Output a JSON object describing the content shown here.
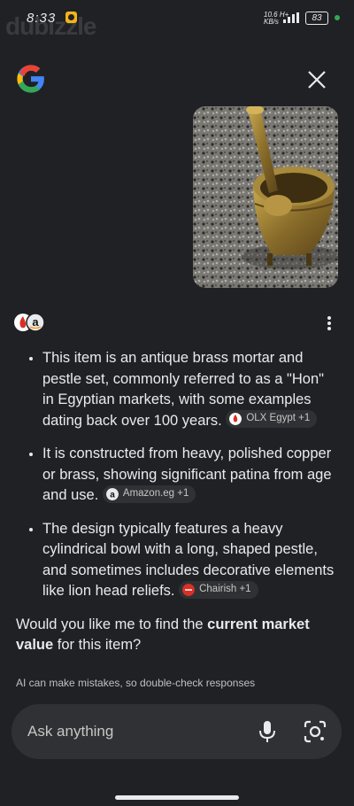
{
  "status_bar": {
    "time": "8:33",
    "net_speed_value": "10.6",
    "net_speed_unit": "KB/s",
    "net_type": "H+",
    "battery": "83",
    "watermark": "dubizzle"
  },
  "header": {
    "logo_icon": "google-g-logo",
    "close_icon": "close-icon"
  },
  "query_image": {
    "description_icon": "brass-mortar-pestle-photo"
  },
  "answer": {
    "source_icons": [
      "olx-icon",
      "amazon-icon"
    ],
    "bullets": [
      {
        "text": "This item is an antique brass mortar and pestle set, commonly referred to as a \"Hon\" in Egyptian markets, with some examples dating back over 100 years.",
        "chip": "OLX Egypt +1",
        "chip_color": "#d93025"
      },
      {
        "text": "It is constructed from heavy, polished copper or brass, showing significant patina from age and use.",
        "chip": "Amazon.eg +1",
        "chip_color": "#e8eaed"
      },
      {
        "text": "The design typically features a heavy cylindrical bowl with a long, shaped pestle, and sometimes includes decorative elements like lion head reliefs.",
        "chip": "Chairish +1",
        "chip_color": "#d93025"
      }
    ],
    "followup_pre": "Would you like me to find the ",
    "followup_bold": "current market value",
    "followup_post": " for this item?"
  },
  "disclaimer": "AI can make mistakes, so double-check responses",
  "input": {
    "placeholder": "Ask anything",
    "mic_icon": "microphone-icon",
    "lens_icon": "google-lens-icon"
  }
}
